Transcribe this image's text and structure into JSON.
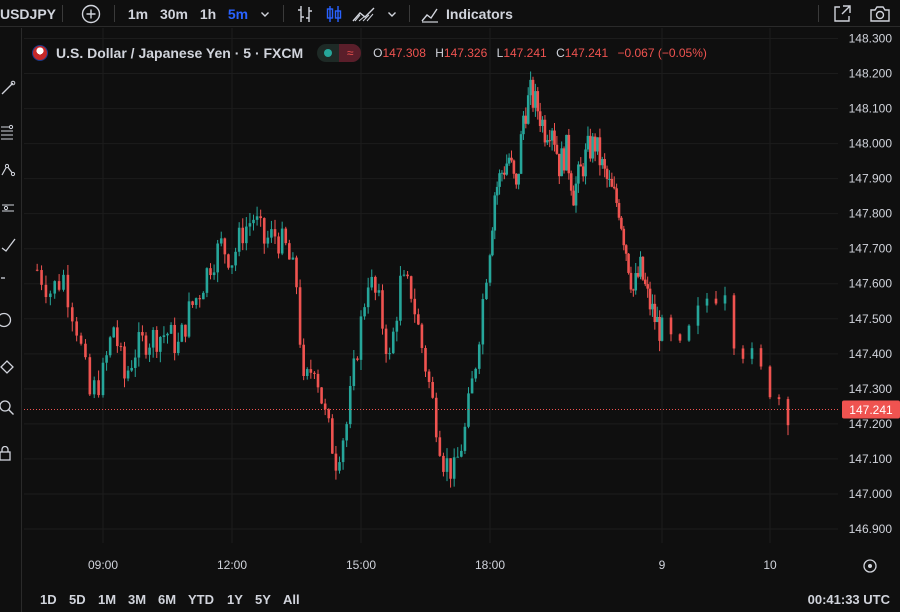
{
  "toolbar": {
    "symbol": "USDJPY",
    "intervals": [
      "1m",
      "30m",
      "1h",
      "5m"
    ],
    "active_interval": "5m",
    "indicators_label": "Indicators",
    "active_color": "#2962ff"
  },
  "legend": {
    "title": "U.S. Dollar / Japanese Yen · 5 · FXCM",
    "open_key": "O",
    "open": "147.308",
    "high_key": "H",
    "high": "147.326",
    "low_key": "L",
    "low": "147.241",
    "close_key": "C",
    "close": "147.241",
    "change": "−0.067 (−0.05%)"
  },
  "bottom": {
    "ranges": [
      "1D",
      "5D",
      "1M",
      "3M",
      "6M",
      "YTD",
      "1Y",
      "5Y",
      "All"
    ],
    "clock": "00:41:33 UTC"
  },
  "colors": {
    "up": "#26a69a",
    "down": "#ef5350",
    "background": "#0f0f0f",
    "grid": "#1c1c1c",
    "axis_text": "#d1d4dc",
    "price_line": "#ef5350"
  },
  "chart_data": {
    "type": "candlestick",
    "x_ticks": [
      "09:00",
      "12:00",
      "15:00",
      "18:00",
      "9",
      "10"
    ],
    "y_ticks": [
      "148.300",
      "148.200",
      "148.100",
      "148.000",
      "147.900",
      "147.800",
      "147.700",
      "147.600",
      "147.500",
      "147.400",
      "147.300",
      "147.200",
      "147.100",
      "147.000",
      "146.900"
    ],
    "ylim": [
      146.86,
      148.33
    ],
    "last_price": 147.241,
    "last_price_label": "147.241",
    "close_path": [
      {
        "t": "07:45",
        "v": 147.64
      },
      {
        "t": "08:00",
        "v": 147.58
      },
      {
        "t": "08:15",
        "v": 147.62
      },
      {
        "t": "08:30",
        "v": 147.48
      },
      {
        "t": "08:45",
        "v": 147.28
      },
      {
        "t": "09:00",
        "v": 147.34
      },
      {
        "t": "09:15",
        "v": 147.48
      },
      {
        "t": "09:30",
        "v": 147.33
      },
      {
        "t": "09:45",
        "v": 147.41
      },
      {
        "t": "10:00",
        "v": 147.44
      },
      {
        "t": "10:30",
        "v": 147.46
      },
      {
        "t": "10:45",
        "v": 147.42
      },
      {
        "t": "11:00",
        "v": 147.52
      },
      {
        "t": "11:15",
        "v": 147.58
      },
      {
        "t": "11:30",
        "v": 147.66
      },
      {
        "t": "11:45",
        "v": 147.71
      },
      {
        "t": "12:00",
        "v": 147.67
      },
      {
        "t": "12:15",
        "v": 147.75
      },
      {
        "t": "12:30",
        "v": 147.79
      },
      {
        "t": "12:45",
        "v": 147.72
      },
      {
        "t": "13:00",
        "v": 147.74
      },
      {
        "t": "13:15",
        "v": 147.7
      },
      {
        "t": "13:30",
        "v": 147.6
      },
      {
        "t": "13:40",
        "v": 147.3
      },
      {
        "t": "13:55",
        "v": 147.38
      },
      {
        "t": "14:10",
        "v": 147.22
      },
      {
        "t": "14:25",
        "v": 147.1
      },
      {
        "t": "14:40",
        "v": 147.2
      },
      {
        "t": "14:55",
        "v": 147.42
      },
      {
        "t": "15:10",
        "v": 147.62
      },
      {
        "t": "15:25",
        "v": 147.54
      },
      {
        "t": "15:40",
        "v": 147.38
      },
      {
        "t": "15:55",
        "v": 147.6
      },
      {
        "t": "16:10",
        "v": 147.58
      },
      {
        "t": "16:25",
        "v": 147.42
      },
      {
        "t": "16:40",
        "v": 147.26
      },
      {
        "t": "16:55",
        "v": 147.1
      },
      {
        "t": "17:10",
        "v": 147.06
      },
      {
        "t": "17:25",
        "v": 147.18
      },
      {
        "t": "17:40",
        "v": 147.38
      },
      {
        "t": "17:55",
        "v": 147.64
      },
      {
        "t": "18:10",
        "v": 147.86
      },
      {
        "t": "18:25",
        "v": 147.92
      },
      {
        "t": "18:40",
        "v": 147.96
      },
      {
        "t": "18:55",
        "v": 147.86
      },
      {
        "t": "19:10",
        "v": 148.08
      },
      {
        "t": "19:25",
        "v": 148.14
      },
      {
        "t": "19:40",
        "v": 148.1
      },
      {
        "t": "19:55",
        "v": 148.04
      },
      {
        "t": "20:10",
        "v": 148.06
      },
      {
        "t": "20:25",
        "v": 147.94
      },
      {
        "t": "20:40",
        "v": 147.98
      },
      {
        "t": "20:55",
        "v": 147.86
      },
      {
        "t": "21:10",
        "v": 147.92
      },
      {
        "t": "21:25",
        "v": 147.98
      },
      {
        "t": "21:40",
        "v": 148.0
      },
      {
        "t": "22:00",
        "v": 147.91
      },
      {
        "t": "22:15",
        "v": 147.86
      },
      {
        "t": "22:30",
        "v": 147.82
      },
      {
        "t": "22:45",
        "v": 147.7
      },
      {
        "t": "23:00",
        "v": 147.58
      },
      {
        "t": "23:15",
        "v": 147.64
      },
      {
        "t": "23:30",
        "v": 147.56
      },
      {
        "t": "23:45",
        "v": 147.5
      },
      {
        "t": "00:00",
        "v": 147.46
      },
      {
        "t": "00:10",
        "v": 147.4
      },
      {
        "t": "00:25",
        "v": 147.56
      },
      {
        "t": "00:35",
        "v": 147.6
      },
      {
        "t": "00:40",
        "v": 147.46
      },
      {
        "t": "00:55",
        "v": 147.34
      },
      {
        "t": "01:05",
        "v": 147.28
      },
      {
        "t": "01:10",
        "v": 147.241
      }
    ]
  }
}
